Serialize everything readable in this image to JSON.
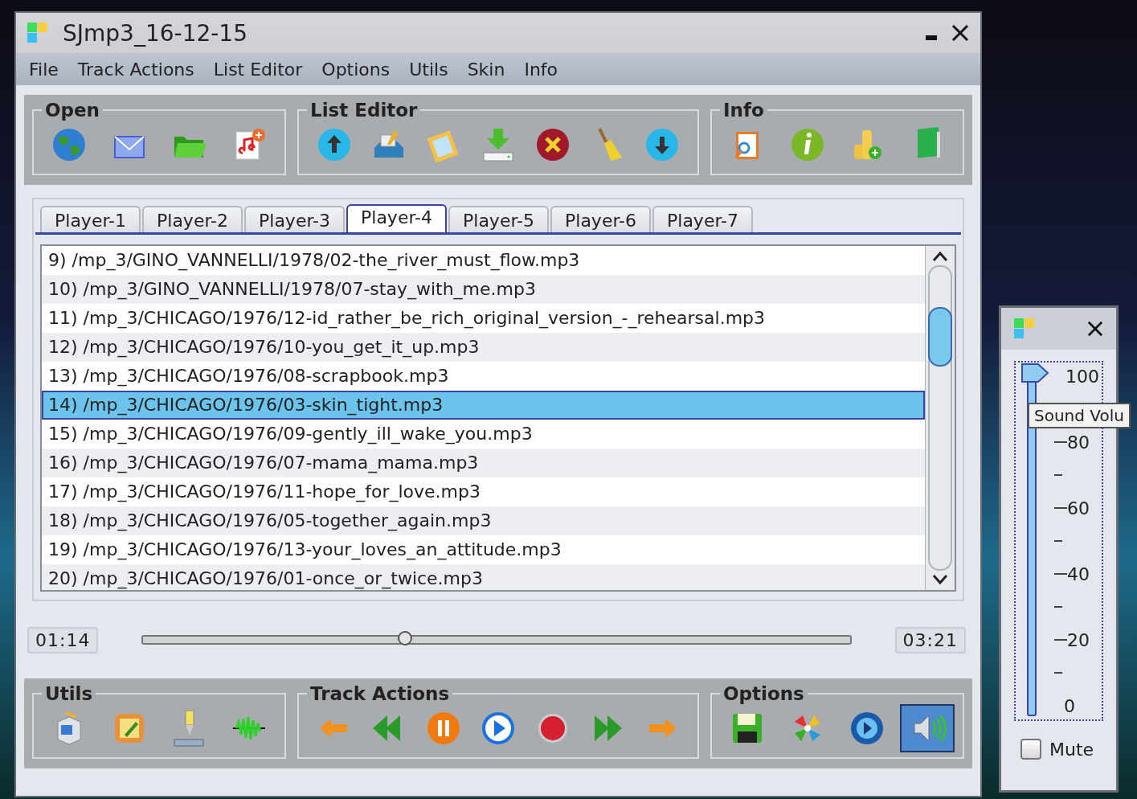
{
  "window": {
    "title": "SJmp3_16-12-15"
  },
  "menu": [
    "File",
    "Track Actions",
    "List Editor",
    "Options",
    "Utils",
    "Skin",
    "Info"
  ],
  "top_groups": [
    {
      "title": "Open",
      "buttons": [
        {
          "pressed": false
        },
        {
          "pressed": false
        },
        {
          "pressed": false
        },
        {
          "pressed": false
        }
      ]
    },
    {
      "title": "List Editor",
      "buttons": [
        {
          "pressed": false
        },
        {
          "pressed": false
        },
        {
          "pressed": false
        },
        {
          "pressed": false
        },
        {
          "pressed": false
        },
        {
          "pressed": false
        },
        {
          "pressed": false
        }
      ]
    },
    {
      "title": "Info",
      "buttons": [
        {
          "pressed": false
        },
        {
          "pressed": false
        },
        {
          "pressed": false
        },
        {
          "pressed": false
        }
      ]
    }
  ],
  "tabs": [
    {
      "label": "Player-1",
      "selected": false
    },
    {
      "label": "Player-2",
      "selected": false
    },
    {
      "label": "Player-3",
      "selected": false
    },
    {
      "label": "Player-4",
      "selected": true
    },
    {
      "label": "Player-5",
      "selected": false
    },
    {
      "label": "Player-6",
      "selected": false
    },
    {
      "label": "Player-7",
      "selected": false
    }
  ],
  "playlist": [
    {
      "text": "9) /mp_3/GINO_VANNELLI/1978/02-the_river_must_flow.mp3",
      "selected": false
    },
    {
      "text": "10) /mp_3/GINO_VANNELLI/1978/07-stay_with_me.mp3",
      "selected": false
    },
    {
      "text": "11) /mp_3/CHICAGO/1976/12-id_rather_be_rich_original_version_-_rehearsal.mp3",
      "selected": false
    },
    {
      "text": "12) /mp_3/CHICAGO/1976/10-you_get_it_up.mp3",
      "selected": false
    },
    {
      "text": "13) /mp_3/CHICAGO/1976/08-scrapbook.mp3",
      "selected": false
    },
    {
      "text": "14) /mp_3/CHICAGO/1976/03-skin_tight.mp3",
      "selected": true
    },
    {
      "text": "15) /mp_3/CHICAGO/1976/09-gently_ill_wake_you.mp3",
      "selected": false
    },
    {
      "text": "16) /mp_3/CHICAGO/1976/07-mama_mama.mp3",
      "selected": false
    },
    {
      "text": "17) /mp_3/CHICAGO/1976/11-hope_for_love.mp3",
      "selected": false
    },
    {
      "text": "18) /mp_3/CHICAGO/1976/05-together_again.mp3",
      "selected": false
    },
    {
      "text": "19) /mp_3/CHICAGO/1976/13-your_loves_an_attitude.mp3",
      "selected": false
    },
    {
      "text": "20) /mp_3/CHICAGO/1976/01-once_or_twice.mp3",
      "selected": false
    }
  ],
  "progress": {
    "elapsed": "01:14",
    "total": "03:21",
    "level": 0.37
  },
  "bottom_groups": [
    {
      "title": "Utils",
      "buttons": [
        {
          "pressed": false
        },
        {
          "pressed": false
        },
        {
          "pressed": false
        },
        {
          "pressed": false
        }
      ]
    },
    {
      "title": "Track Actions",
      "buttons": [
        {
          "pressed": false
        },
        {
          "pressed": false
        },
        {
          "pressed": false
        },
        {
          "pressed": false
        },
        {
          "pressed": false
        },
        {
          "pressed": false
        },
        {
          "pressed": false
        }
      ]
    },
    {
      "title": "Options",
      "buttons": [
        {
          "pressed": false
        },
        {
          "pressed": false
        },
        {
          "pressed": false
        },
        {
          "pressed": true
        }
      ]
    }
  ],
  "volume": {
    "level": 1.0,
    "ticks": [
      "100",
      "80",
      "60",
      "40",
      "20",
      "0"
    ],
    "tooltip": "Sound Volu",
    "mute": {
      "label": "Mute",
      "checked": false
    }
  }
}
